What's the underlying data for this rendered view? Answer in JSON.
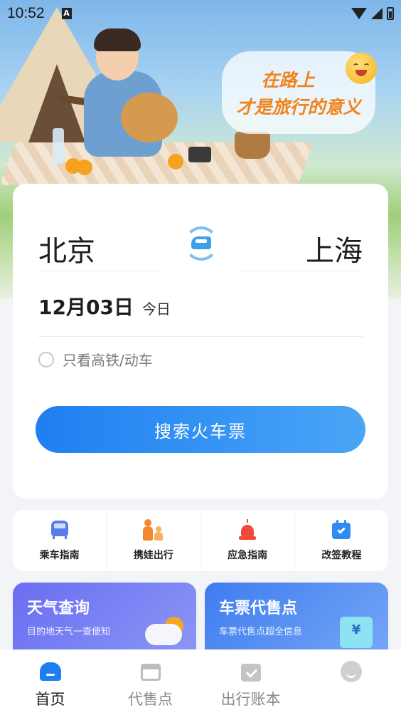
{
  "status_bar": {
    "time": "10:52",
    "indicator": "A"
  },
  "banner": {
    "slogan_line1": "在路上",
    "slogan_line2": "才是旅行的意义"
  },
  "search": {
    "from_station": "北京",
    "to_station": "上海",
    "date": "12月03日",
    "date_note": "今日",
    "high_speed_only_label": "只看高铁/动车",
    "high_speed_only_checked": false,
    "search_button_label": "搜索火车票"
  },
  "quick_entries": [
    {
      "label": "乘车指南",
      "icon": "train-icon"
    },
    {
      "label": "携娃出行",
      "icon": "family-icon"
    },
    {
      "label": "应急指南",
      "icon": "alarm-icon"
    },
    {
      "label": "改签教程",
      "icon": "calendar-check-icon"
    }
  ],
  "features": {
    "weather": {
      "title": "天气查询",
      "desc": "目的地天气一查便知"
    },
    "outlet": {
      "title": "车票代售点",
      "desc": "车票代售点超全信息",
      "icon_text": "¥"
    }
  },
  "bottom_nav": [
    {
      "label": "首页",
      "active": true
    },
    {
      "label": "代售点",
      "active": false
    },
    {
      "label": "出行账本",
      "active": false
    },
    {
      "label": "",
      "active": false
    }
  ],
  "colors": {
    "accent": "#1e7df0",
    "slogan": "#f2821c",
    "search_gradient_start": "#1f7ff0",
    "search_gradient_end": "#4aa5f7"
  }
}
